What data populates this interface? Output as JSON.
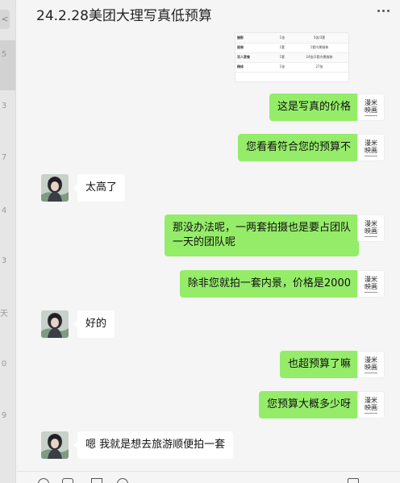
{
  "window": {
    "title": "24.2.28美团大理写真低预算",
    "collapse_glyph": "<",
    "left_fragments": [
      "5",
      "3",
      "7",
      "4",
      "3",
      "天",
      "0",
      "9"
    ]
  },
  "image_message": {
    "rows": [
      [
        "摄影",
        "1张",
        "5张/3套"
      ],
      [
        "服装",
        "1套",
        "1套内景服装"
      ],
      [
        "双人套餐",
        "1套",
        "24张/2套内景服装"
      ],
      [
        "精修",
        "1张",
        "27张"
      ]
    ]
  },
  "messages": [
    {
      "side": "out",
      "text": "这是写真的价格"
    },
    {
      "side": "out",
      "text": "您看看符合您的预算不"
    },
    {
      "side": "in",
      "text": "太高了"
    },
    {
      "side": "out",
      "lines": [
        "那没办法呢，一两套拍摄也是要占团队",
        "一天的团队呢"
      ]
    },
    {
      "side": "out",
      "text": "除非您就拍一套内景，价格是2000"
    },
    {
      "side": "in",
      "text": "好的"
    },
    {
      "side": "out",
      "text": "也超预算了嘛"
    },
    {
      "side": "out",
      "text": "您预算大概多少呀"
    },
    {
      "side": "in",
      "text": "嗯 我就是想去旅游顺便拍一套"
    }
  ],
  "brand_avatar": {
    "line1": "漫米",
    "line2": "映画"
  },
  "colors": {
    "outgoing_bubble": "#95ec69",
    "incoming_bubble": "#ffffff",
    "background": "#f5f5f5"
  }
}
